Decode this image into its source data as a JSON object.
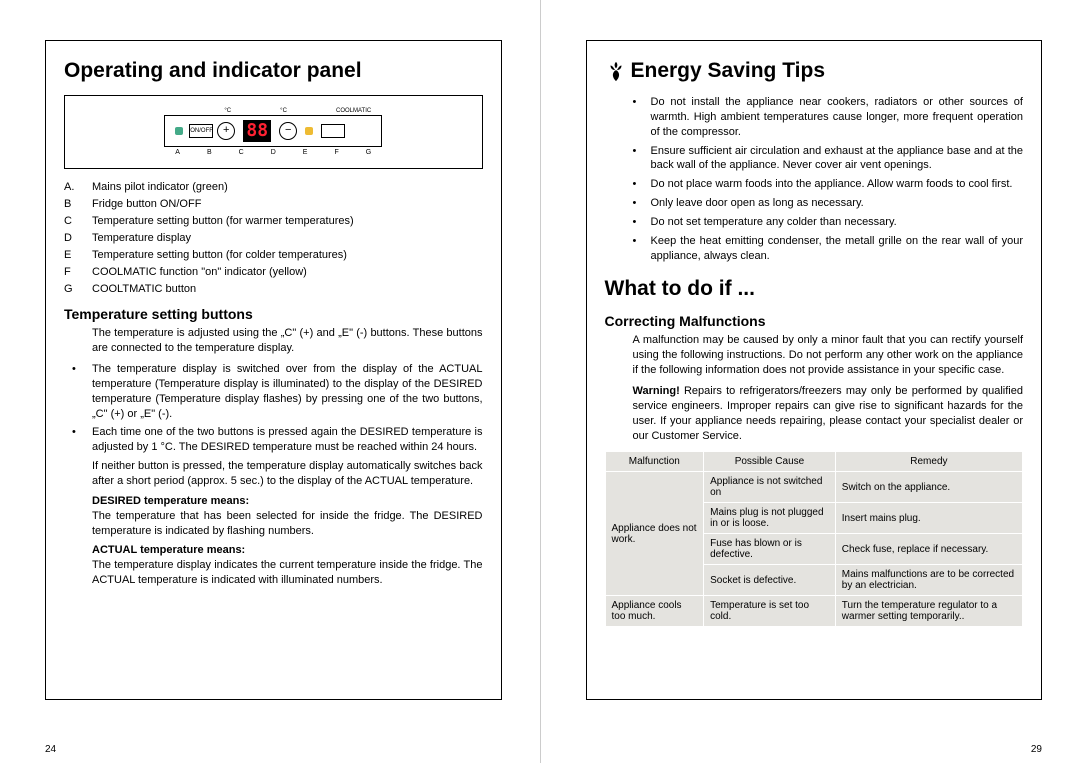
{
  "left": {
    "title": "Operating and indicator panel",
    "panel": {
      "top_c1": "°C",
      "top_c2": "°C",
      "top_cool": "COOLMATIC",
      "onoff": "ON/OFF",
      "display": "88",
      "letters": [
        "A",
        "B",
        "C",
        "D",
        "E",
        "F",
        "G"
      ]
    },
    "legend": [
      {
        "k": "A.",
        "v": "Mains pilot indicator (green)"
      },
      {
        "k": "B",
        "v": "Fridge button ON/OFF"
      },
      {
        "k": "C",
        "v": "Temperature setting button (for warmer temperatures)"
      },
      {
        "k": "D",
        "v": "Temperature display"
      },
      {
        "k": "E",
        "v": "Temperature setting button (for colder temperatures)"
      },
      {
        "k": "F",
        "v": "COOLMATIC function \"on\" indicator (yellow)"
      },
      {
        "k": "G",
        "v": "COOLTMATIC button"
      }
    ],
    "h2a": "Temperature setting buttons",
    "p1": "The temperature is adjusted using the „C\" (+) and „E\" (-) buttons. These buttons are connected to the temperature display.",
    "b1": "The temperature display is switched over from the display of the ACTUAL temperature (Temperature display is illuminated) to the display of the DESIRED temperature (Temperature display flashes) by pressing one of the two buttons, „C\" (+) or „E\" (-).",
    "b2": "Each time one of the two buttons is pressed again the DESIRED temperature is adjusted by 1 °C. The DESIRED temperature must be reached within 24 hours.",
    "p2": "If neither button is pressed, the temperature display automatically switches back after a short period (approx. 5 sec.) to the display of the ACTUAL temperature.",
    "sub1": "DESIRED temperature means:",
    "p3": "The temperature that has been selected for inside the fridge. The DESIRED temperature is indicated by flashing numbers.",
    "sub2": "ACTUAL temperature means:",
    "p4": "The temperature display indicates the current temperature inside the fridge. The ACTUAL temperature is indicated with illuminated numbers.",
    "pagenum": "24"
  },
  "right": {
    "h1a": "Energy Saving Tips",
    "tips": [
      "Do not install the appliance near cookers, radiators or other sources of warmth. High ambient temperatures cause longer, more frequent operation of the compressor.",
      "Ensure sufficient air circulation and exhaust at the appliance base and at the back wall of the appliance. Never cover air vent openings.",
      "Do not place warm foods into the appliance. Allow warm foods to cool first.",
      "Only leave door open as long as necessary.",
      "Do not set temperature any colder than necessary.",
      "Keep the heat emitting condenser, the metall grille on the rear wall of your appliance, always clean."
    ],
    "h1b": "What to do if ...",
    "h2b": "Correcting Malfunctions",
    "pw1": "A malfunction may be caused by only a minor fault that you can rectify yourself using the following instructions. Do not perform any other work on the appliance if the following information does not provide assistance in your specific case.",
    "pw2a": "Warning!",
    "pw2b": "  Repairs to refrigerators/freezers may only be performed by qualified service engineers. Improper repairs can give rise to significant hazards for the user. If your appliance needs repairing, please contact your specialist dealer or our Customer Service.",
    "table": {
      "headers": [
        "Malfunction",
        "Possible Cause",
        "Remedy"
      ],
      "rows": [
        {
          "m": "Appliance does not work.",
          "c": "Appliance is not switched on",
          "r": "Switch on the appliance."
        },
        {
          "m": "",
          "c": "Mains plug is not plugged in or is loose.",
          "r": "Insert mains plug."
        },
        {
          "m": "",
          "c": "Fuse has blown or is defective.",
          "r": "Check fuse, replace if necessary."
        },
        {
          "m": "",
          "c": "Socket is defective.",
          "r": "Mains malfunctions are to be corrected by an electrician."
        },
        {
          "m": "Appliance cools too much.",
          "c": "Temperature is set too cold.",
          "r": "Turn the temperature regulator to a warmer setting temporarily.."
        }
      ]
    },
    "pagenum": "29"
  }
}
